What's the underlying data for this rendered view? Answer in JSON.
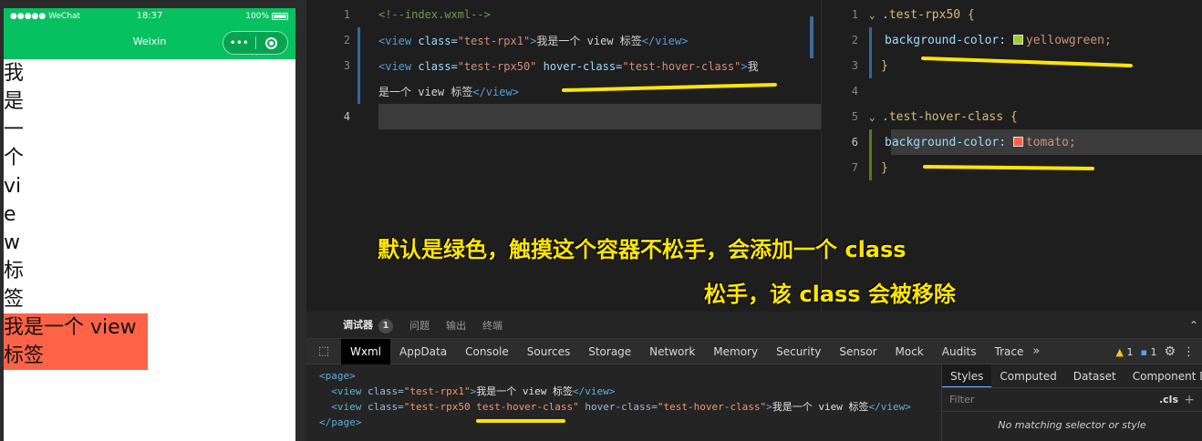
{
  "simulator": {
    "carrier": "●●●●● WeChat",
    "time": "18:37",
    "battery": "100%",
    "nav_title": "Weixin",
    "capsule_menu": "•••",
    "view1_text": "我是一个 view 标签",
    "view2_text": "我是一个 view 标签"
  },
  "wxml_editor": {
    "line1": "<!--index.wxml-->",
    "line2_tag_open": "<view",
    "line2_attr": " class=",
    "line2_val": "\"test-rpx1\"",
    "line2_text": "我是一个 view 标签",
    "line2_tag_close": "</view>",
    "line3_attr2": " hover-class=",
    "line3_val1": "\"test-rpx50\"",
    "line3_val2": "\"test-hover-class\"",
    "line3_text_a": "我",
    "line3b_text": "是一个 view 标签",
    "line_numbers": [
      "1",
      "2",
      "3",
      "4"
    ]
  },
  "css_editor": {
    "sel1": ".test-rpx50 {",
    "prop1": "background-color:",
    "val1": "yellowgreen;",
    "close1": "}",
    "sel2": ".test-hover-class {",
    "prop2": "background-color:",
    "val2": "tomato;",
    "close2": "}",
    "line_numbers": [
      "1",
      "2",
      "3",
      "4",
      "5",
      "6",
      "7"
    ],
    "swatch1": "#9acd32",
    "swatch2": "#ff6347"
  },
  "captions": {
    "line1": "默认是绿色，触摸这个容器不松手，会添加一个 class",
    "line2": "松手，该 class 会被移除"
  },
  "debugger": {
    "tabs": [
      "调试器",
      "问题",
      "输出",
      "终端"
    ],
    "debugger_badge": "1",
    "dev_tabs": [
      "Wxml",
      "AppData",
      "Console",
      "Sources",
      "Storage",
      "Network",
      "Memory",
      "Security",
      "Sensor",
      "Mock",
      "Audits",
      "Trace"
    ],
    "warn_count": "1",
    "msg_count": "1",
    "dom": {
      "page_open": "<page>",
      "row1_tag": "<view",
      "row1_attr": " class=",
      "row1_val": "\"test-rpx1\"",
      "row1_text": "我是一个 view 标签",
      "row1_close": "</view>",
      "row2_val": "\"test-rpx50 test-hover-class\"",
      "row2_attr2": " hover-class=",
      "row2_val2": "\"test-hover-class\"",
      "page_close": "</page>"
    },
    "style_tabs": [
      "Styles",
      "Computed",
      "Dataset",
      "Component Data"
    ],
    "filter_placeholder": "Filter",
    "cls_label": ".cls",
    "no_match": "No matching selector or style"
  }
}
